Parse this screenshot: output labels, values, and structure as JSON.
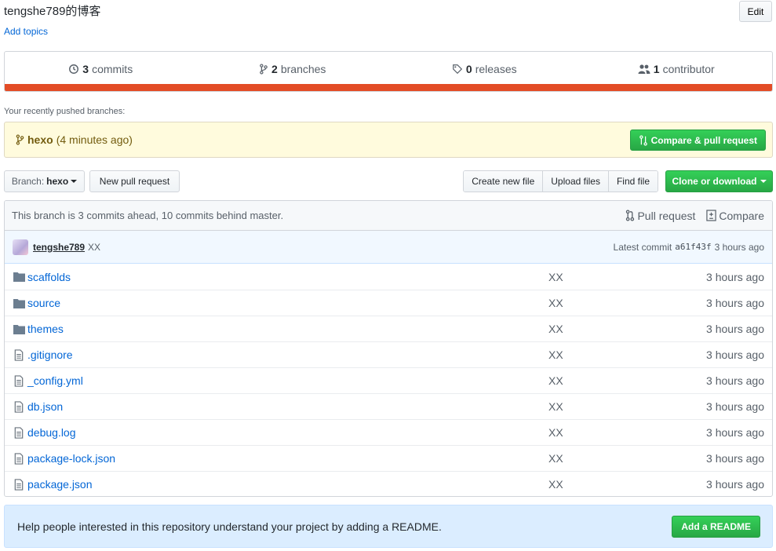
{
  "repo": {
    "description": "tengshe789的博客",
    "add_topics": "Add topics",
    "edit_label": "Edit"
  },
  "summary": {
    "commits_count": "3",
    "commits_label": "commits",
    "branches_count": "2",
    "branches_label": "branches",
    "releases_count": "0",
    "releases_label": "releases",
    "contributors_count": "1",
    "contributors_label": "contributor",
    "language_color": "#e34c26"
  },
  "recent": {
    "label": "Your recently pushed branches:",
    "branch": "hexo",
    "time": "(4 minutes ago)",
    "compare_label": "Compare & pull request"
  },
  "toolbar": {
    "branch_prefix": "Branch:",
    "branch_name": "hexo",
    "new_pr": "New pull request",
    "create_file": "Create new file",
    "upload_files": "Upload files",
    "find_file": "Find file",
    "clone": "Clone or download"
  },
  "branch_info": {
    "text": "This branch is 3 commits ahead, 10 commits behind master.",
    "pull_request": "Pull request",
    "compare": "Compare"
  },
  "latest_commit": {
    "author": "tengshe789",
    "message": "XX",
    "label": "Latest commit",
    "sha": "a61f43f",
    "time": "3 hours ago"
  },
  "files": [
    {
      "type": "dir",
      "name": "scaffolds",
      "message": "XX",
      "age": "3 hours ago"
    },
    {
      "type": "dir",
      "name": "source",
      "message": "XX",
      "age": "3 hours ago"
    },
    {
      "type": "dir",
      "name": "themes",
      "message": "XX",
      "age": "3 hours ago"
    },
    {
      "type": "file",
      "name": ".gitignore",
      "message": "XX",
      "age": "3 hours ago"
    },
    {
      "type": "file",
      "name": "_config.yml",
      "message": "XX",
      "age": "3 hours ago"
    },
    {
      "type": "file",
      "name": "db.json",
      "message": "XX",
      "age": "3 hours ago"
    },
    {
      "type": "file",
      "name": "debug.log",
      "message": "XX",
      "age": "3 hours ago"
    },
    {
      "type": "file",
      "name": "package-lock.json",
      "message": "XX",
      "age": "3 hours ago"
    },
    {
      "type": "file",
      "name": "package.json",
      "message": "XX",
      "age": "3 hours ago"
    }
  ],
  "readme": {
    "text": "Help people interested in this repository understand your project by adding a README.",
    "button": "Add a README"
  }
}
